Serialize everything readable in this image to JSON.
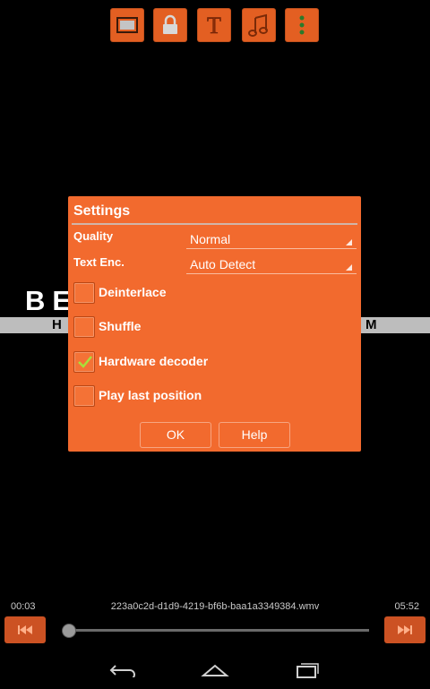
{
  "toolbar": {
    "buttons": [
      {
        "icon": "screen-icon",
        "label": "Screen"
      },
      {
        "icon": "lock-icon",
        "label": "Lock"
      },
      {
        "icon": "subtitle-icon",
        "label": "T"
      },
      {
        "icon": "music-note-icon",
        "label": "Audio"
      },
      {
        "icon": "overflow-menu-icon",
        "label": "More"
      }
    ],
    "accent": "#e35f22"
  },
  "video_frame": {
    "logo_partial_left": "BE",
    "band_left": "H",
    "band_right": "M"
  },
  "dialog": {
    "title": "Settings",
    "quality_label": "Quality",
    "quality_value": "Normal",
    "text_enc_label": "Text Enc.",
    "text_enc_value": "Auto Detect",
    "options": [
      {
        "label": "Deinterlace",
        "checked": false
      },
      {
        "label": "Shuffle",
        "checked": false
      },
      {
        "label": "Hardware decoder",
        "checked": true
      },
      {
        "label": "Play last position",
        "checked": false
      }
    ],
    "ok_label": "OK",
    "help_label": "Help",
    "background": "#f26a2e"
  },
  "player": {
    "elapsed": "00:03",
    "duration": "05:52",
    "file_name": "223a0c2d-d1d9-4219-bf6b-baa1a3349384.wmv",
    "progress": 0.0085
  },
  "nav_bar": {
    "back": "back-icon",
    "home": "home-icon",
    "recents": "recents-icon"
  }
}
